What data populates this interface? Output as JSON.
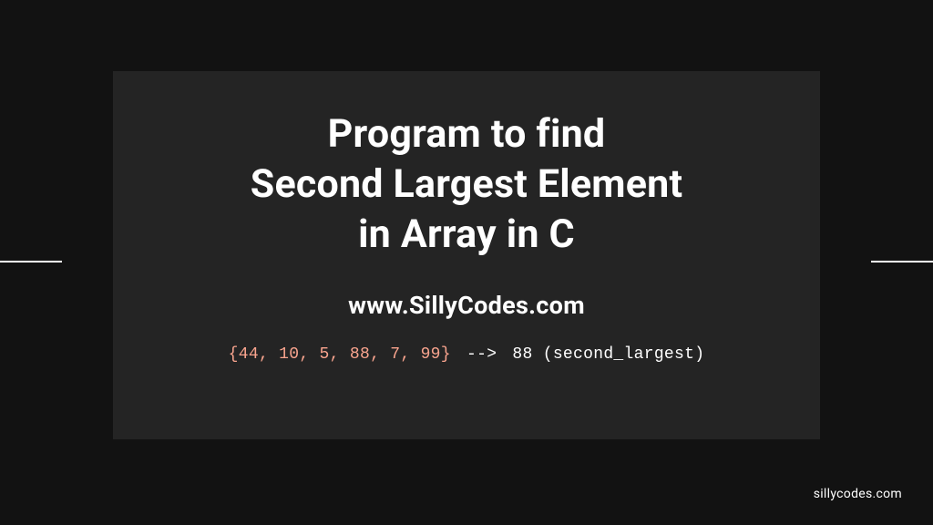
{
  "title": {
    "line1": "Program to find",
    "line2": "Second Largest Element",
    "line3": "in Array in C"
  },
  "url": "www.SillyCodes.com",
  "code": {
    "array": "{44, 10, 5, 88, 7, 99}",
    "arrow": " --> ",
    "result": "88 (second_largest)"
  },
  "footer": "sillycodes.com"
}
